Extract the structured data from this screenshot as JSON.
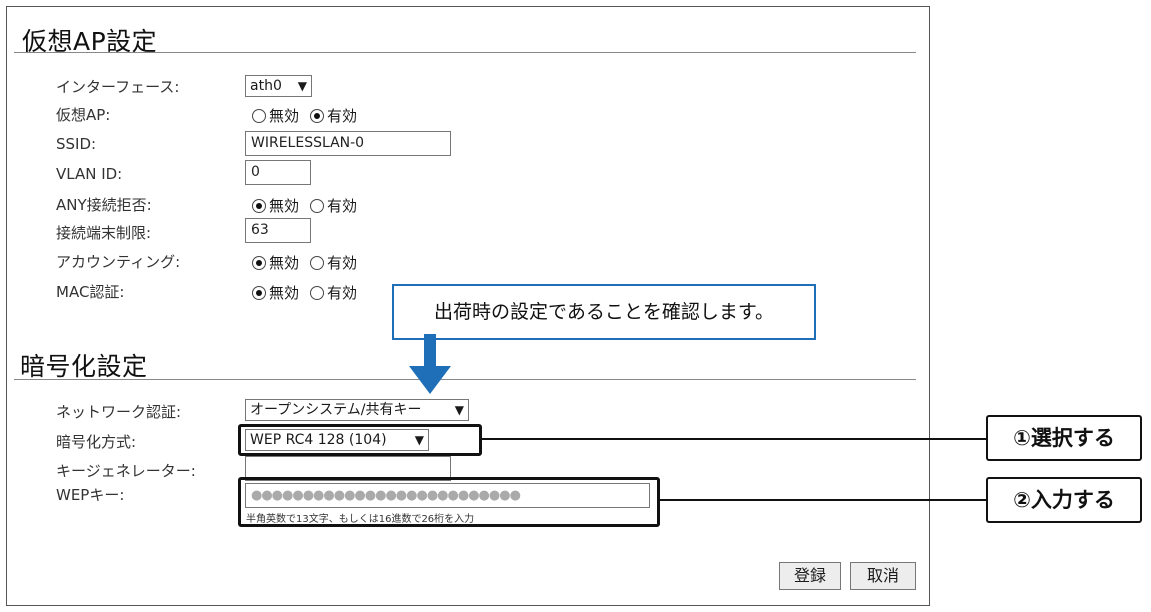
{
  "virtual_ap": {
    "title": "仮想AP設定",
    "interface_label": "インターフェース:",
    "interface_value": "ath0",
    "vap_label": "仮想AP:",
    "vap_options": [
      "無効",
      "有効"
    ],
    "vap_selected": "有効",
    "ssid_label": "SSID:",
    "ssid_value": "WIRELESSLAN-0",
    "vlan_label": "VLAN ID:",
    "vlan_value": "0",
    "any_label": "ANY接続拒否:",
    "any_options": [
      "無効",
      "有効"
    ],
    "any_selected": "無効",
    "limit_label": "接続端末制限:",
    "limit_value": "63",
    "accounting_label": "アカウンティング:",
    "accounting_options": [
      "無効",
      "有効"
    ],
    "accounting_selected": "無効",
    "mac_label": "MAC認証:",
    "mac_options": [
      "無効",
      "有効"
    ],
    "mac_selected": "無効"
  },
  "encryption": {
    "title": "暗号化設定",
    "network_auth_label": "ネットワーク認証:",
    "network_auth_value": "オープンシステム/共有キー",
    "method_label": "暗号化方式:",
    "method_value": "WEP RC4 128 (104)",
    "keygen_label": "キージェネレーター:",
    "keygen_value": "",
    "wep_label": "WEPキー:",
    "wep_value": "●●●●●●●●●●●●●●●●●●●●●●●●●●",
    "wep_hint": "半角英数で13文字、もしくは16進数で26桁を入力"
  },
  "buttons": {
    "register": "登録",
    "cancel": "取消"
  },
  "annotations": {
    "callout": "出荷時の設定であることを確認します。",
    "step1": "①選択する",
    "step2": "②入力する"
  },
  "colors": {
    "callout_accent": "#1e6fb8"
  }
}
